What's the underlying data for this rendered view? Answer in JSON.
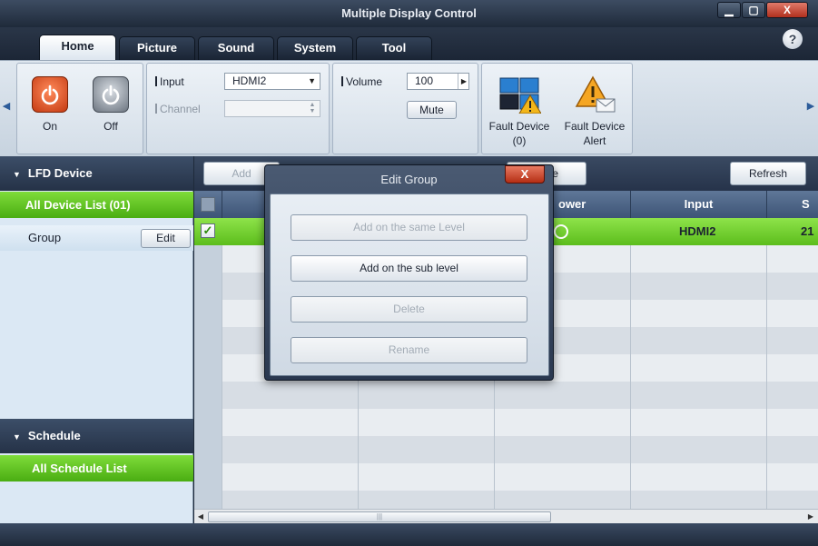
{
  "window": {
    "title": "Multiple Display Control",
    "minimize": "▁",
    "maximize": "▢",
    "close": "X",
    "help": "?"
  },
  "tabs": [
    {
      "label": "Home",
      "active": true
    },
    {
      "label": "Picture"
    },
    {
      "label": "Sound"
    },
    {
      "label": "System"
    },
    {
      "label": "Tool"
    }
  ],
  "ribbon": {
    "power_on_label": "On",
    "power_off_label": "Off",
    "input_label": "Input",
    "input_value": "HDMI2",
    "channel_label": "Channel",
    "channel_value": "",
    "volume_label": "Volume",
    "volume_value": "100",
    "mute_label": "Mute",
    "fault_device_label": "Fault Device",
    "fault_device_count": "(0)",
    "fault_alert_label_1": "Fault Device",
    "fault_alert_label_2": "Alert"
  },
  "sidebar": {
    "lfd_header": "LFD Device",
    "all_devices": "All Device List (01)",
    "group_label": "Group",
    "edit_label": "Edit",
    "schedule_header": "Schedule",
    "all_schedules": "All Schedule List"
  },
  "toolbar": {
    "add_label": "Add",
    "delete_partial": "te",
    "refresh_label": "Refresh"
  },
  "grid": {
    "headers": {
      "power_partial": "ower",
      "input": "Input",
      "next_partial": "S"
    },
    "row1": {
      "checked": "✓",
      "input": "HDMI2",
      "next_partial": "21"
    }
  },
  "dialog": {
    "title": "Edit Group",
    "close": "X",
    "buttons": {
      "same_level": "Add on the same Level",
      "sub_level": "Add on the sub level",
      "delete": "Delete",
      "rename": "Rename"
    }
  },
  "colors": {
    "accent_green": "#5cbd1c",
    "title_dark": "#26334a",
    "power_on": "#c43a12"
  }
}
